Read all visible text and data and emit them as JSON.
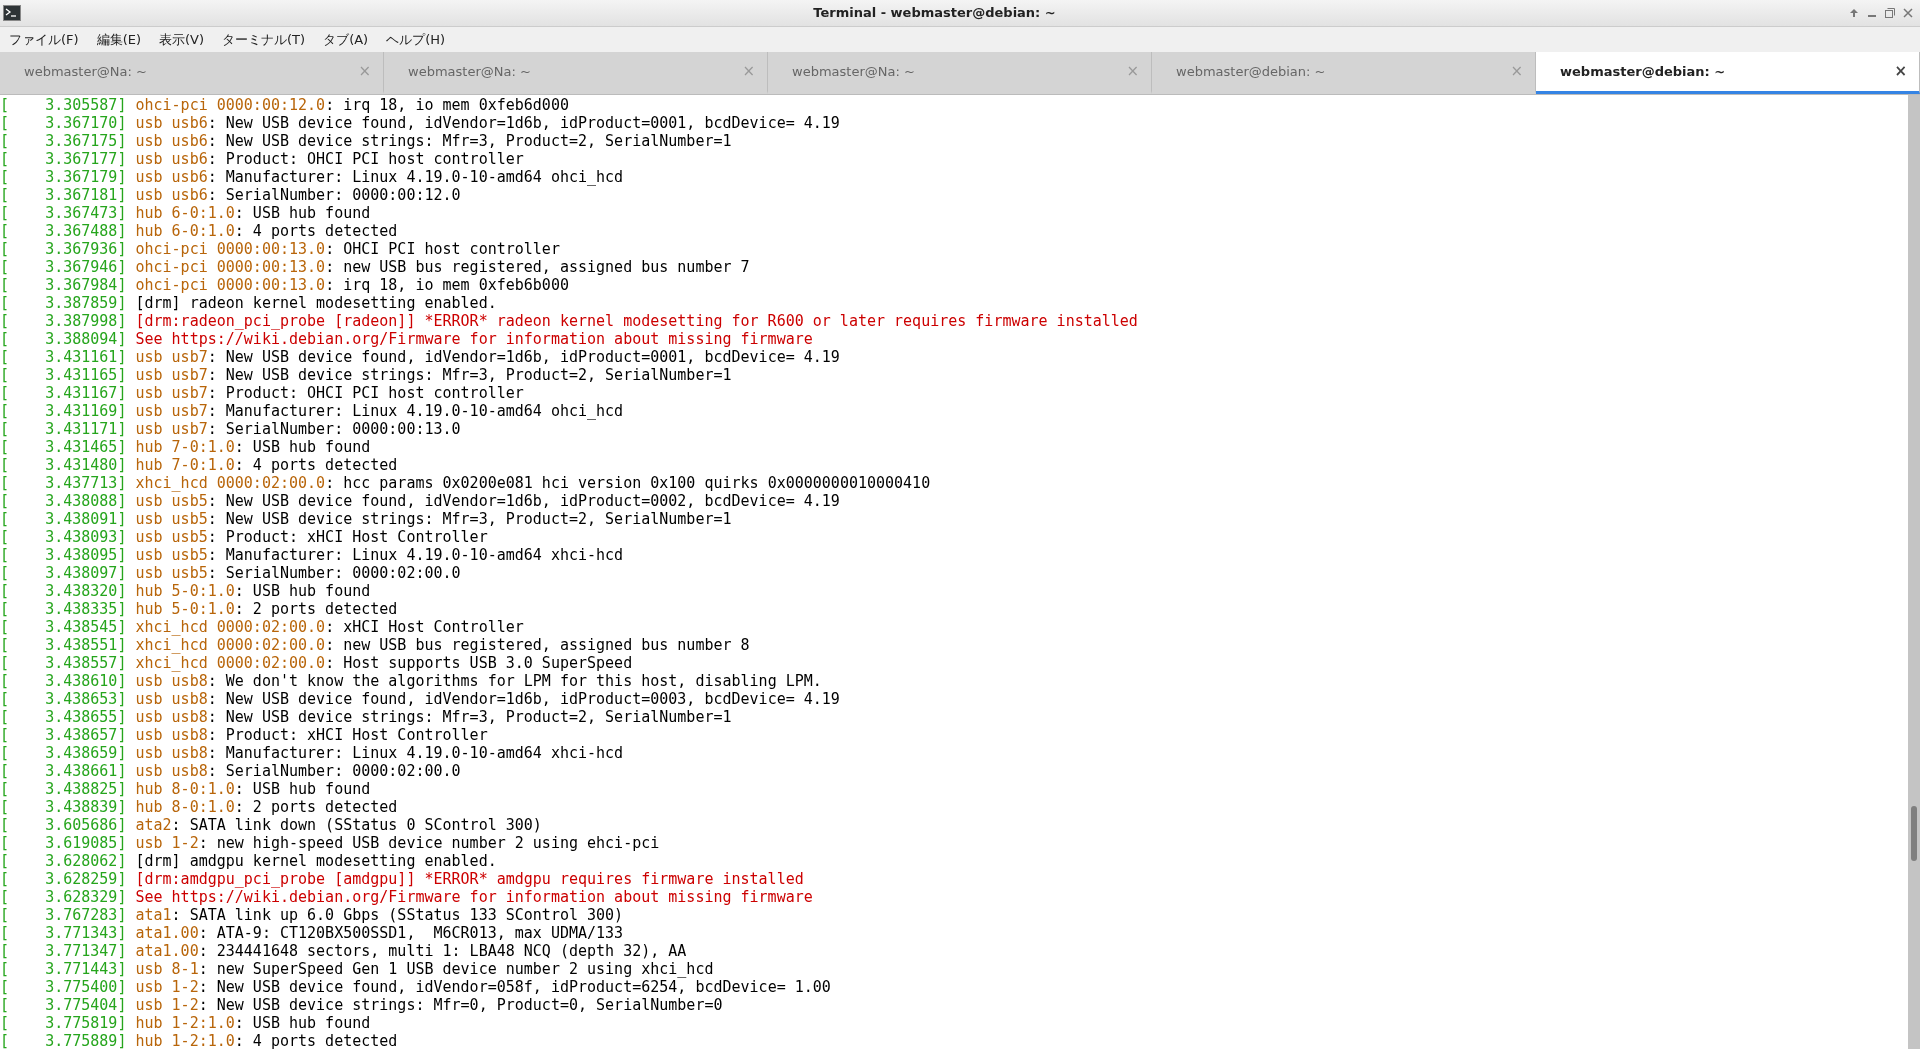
{
  "window": {
    "title": "Terminal - webmaster@debian: ~"
  },
  "menu": [
    "ファイル(F)",
    "編集(E)",
    "表示(V)",
    "ターミナル(T)",
    "タブ(A)",
    "ヘルプ(H)"
  ],
  "tabs": [
    {
      "label": "webmaster@Na: ~",
      "selected": false
    },
    {
      "label": "webmaster@Na: ~",
      "selected": false
    },
    {
      "label": "webmaster@Na: ~",
      "selected": false
    },
    {
      "label": "webmaster@debian: ~",
      "selected": false
    },
    {
      "label": "webmaster@debian: ~",
      "selected": true
    }
  ],
  "tab_close": "×",
  "lines": [
    {
      "kind": "normal",
      "timestamp": "[    3.305587]",
      "source": "ohci-pci 0000:00:12.0",
      "text": ": irq 18, io mem 0xfeb6d000"
    },
    {
      "kind": "normal",
      "timestamp": "[    3.367170]",
      "source": "usb usb6",
      "text": ": New USB device found, idVendor=1d6b, idProduct=0001, bcdDevice= 4.19"
    },
    {
      "kind": "normal",
      "timestamp": "[    3.367175]",
      "source": "usb usb6",
      "text": ": New USB device strings: Mfr=3, Product=2, SerialNumber=1"
    },
    {
      "kind": "normal",
      "timestamp": "[    3.367177]",
      "source": "usb usb6",
      "text": ": Product: OHCI PCI host controller"
    },
    {
      "kind": "normal",
      "timestamp": "[    3.367179]",
      "source": "usb usb6",
      "text": ": Manufacturer: Linux 4.19.0-10-amd64 ohci_hcd"
    },
    {
      "kind": "normal",
      "timestamp": "[    3.367181]",
      "source": "usb usb6",
      "text": ": SerialNumber: 0000:00:12.0"
    },
    {
      "kind": "normal",
      "timestamp": "[    3.367473]",
      "source": "hub 6-0:1.0",
      "text": ": USB hub found"
    },
    {
      "kind": "normal",
      "timestamp": "[    3.367488]",
      "source": "hub 6-0:1.0",
      "text": ": 4 ports detected"
    },
    {
      "kind": "normal",
      "timestamp": "[    3.367936]",
      "source": "ohci-pci 0000:00:13.0",
      "text": ": OHCI PCI host controller"
    },
    {
      "kind": "normal",
      "timestamp": "[    3.367946]",
      "source": "ohci-pci 0000:00:13.0",
      "text": ": new USB bus registered, assigned bus number 7"
    },
    {
      "kind": "normal",
      "timestamp": "[    3.367984]",
      "source": "ohci-pci 0000:00:13.0",
      "text": ": irq 18, io mem 0xfeb6b000"
    },
    {
      "kind": "normal",
      "timestamp": "[    3.387859]",
      "text": "[drm] radeon kernel modesetting enabled."
    },
    {
      "kind": "error",
      "timestamp": "[    3.387998]",
      "text": "[drm:radeon_pci_probe [radeon]] *ERROR* radeon kernel modesetting for R600 or later requires firmware installed"
    },
    {
      "kind": "error",
      "timestamp": "[    3.388094]",
      "text": "See https://wiki.debian.org/Firmware for information about missing firmware"
    },
    {
      "kind": "normal",
      "timestamp": "[    3.431161]",
      "source": "usb usb7",
      "text": ": New USB device found, idVendor=1d6b, idProduct=0001, bcdDevice= 4.19"
    },
    {
      "kind": "normal",
      "timestamp": "[    3.431165]",
      "source": "usb usb7",
      "text": ": New USB device strings: Mfr=3, Product=2, SerialNumber=1"
    },
    {
      "kind": "normal",
      "timestamp": "[    3.431167]",
      "source": "usb usb7",
      "text": ": Product: OHCI PCI host controller"
    },
    {
      "kind": "normal",
      "timestamp": "[    3.431169]",
      "source": "usb usb7",
      "text": ": Manufacturer: Linux 4.19.0-10-amd64 ohci_hcd"
    },
    {
      "kind": "normal",
      "timestamp": "[    3.431171]",
      "source": "usb usb7",
      "text": ": SerialNumber: 0000:00:13.0"
    },
    {
      "kind": "normal",
      "timestamp": "[    3.431465]",
      "source": "hub 7-0:1.0",
      "text": ": USB hub found"
    },
    {
      "kind": "normal",
      "timestamp": "[    3.431480]",
      "source": "hub 7-0:1.0",
      "text": ": 4 ports detected"
    },
    {
      "kind": "normal",
      "timestamp": "[    3.437713]",
      "source": "xhci_hcd 0000:02:00.0",
      "text": ": hcc params 0x0200e081 hci version 0x100 quirks 0x0000000010000410"
    },
    {
      "kind": "normal",
      "timestamp": "[    3.438088]",
      "source": "usb usb5",
      "text": ": New USB device found, idVendor=1d6b, idProduct=0002, bcdDevice= 4.19"
    },
    {
      "kind": "normal",
      "timestamp": "[    3.438091]",
      "source": "usb usb5",
      "text": ": New USB device strings: Mfr=3, Product=2, SerialNumber=1"
    },
    {
      "kind": "normal",
      "timestamp": "[    3.438093]",
      "source": "usb usb5",
      "text": ": Product: xHCI Host Controller"
    },
    {
      "kind": "normal",
      "timestamp": "[    3.438095]",
      "source": "usb usb5",
      "text": ": Manufacturer: Linux 4.19.0-10-amd64 xhci-hcd"
    },
    {
      "kind": "normal",
      "timestamp": "[    3.438097]",
      "source": "usb usb5",
      "text": ": SerialNumber: 0000:02:00.0"
    },
    {
      "kind": "normal",
      "timestamp": "[    3.438320]",
      "source": "hub 5-0:1.0",
      "text": ": USB hub found"
    },
    {
      "kind": "normal",
      "timestamp": "[    3.438335]",
      "source": "hub 5-0:1.0",
      "text": ": 2 ports detected"
    },
    {
      "kind": "normal",
      "timestamp": "[    3.438545]",
      "source": "xhci_hcd 0000:02:00.0",
      "text": ": xHCI Host Controller"
    },
    {
      "kind": "normal",
      "timestamp": "[    3.438551]",
      "source": "xhci_hcd 0000:02:00.0",
      "text": ": new USB bus registered, assigned bus number 8"
    },
    {
      "kind": "normal",
      "timestamp": "[    3.438557]",
      "source": "xhci_hcd 0000:02:00.0",
      "text": ": Host supports USB 3.0 SuperSpeed"
    },
    {
      "kind": "normal",
      "timestamp": "[    3.438610]",
      "source": "usb usb8",
      "text": ": We don't know the algorithms for LPM for this host, disabling LPM."
    },
    {
      "kind": "normal",
      "timestamp": "[    3.438653]",
      "source": "usb usb8",
      "text": ": New USB device found, idVendor=1d6b, idProduct=0003, bcdDevice= 4.19"
    },
    {
      "kind": "normal",
      "timestamp": "[    3.438655]",
      "source": "usb usb8",
      "text": ": New USB device strings: Mfr=3, Product=2, SerialNumber=1"
    },
    {
      "kind": "normal",
      "timestamp": "[    3.438657]",
      "source": "usb usb8",
      "text": ": Product: xHCI Host Controller"
    },
    {
      "kind": "normal",
      "timestamp": "[    3.438659]",
      "source": "usb usb8",
      "text": ": Manufacturer: Linux 4.19.0-10-amd64 xhci-hcd"
    },
    {
      "kind": "normal",
      "timestamp": "[    3.438661]",
      "source": "usb usb8",
      "text": ": SerialNumber: 0000:02:00.0"
    },
    {
      "kind": "normal",
      "timestamp": "[    3.438825]",
      "source": "hub 8-0:1.0",
      "text": ": USB hub found"
    },
    {
      "kind": "normal",
      "timestamp": "[    3.438839]",
      "source": "hub 8-0:1.0",
      "text": ": 2 ports detected"
    },
    {
      "kind": "normal",
      "timestamp": "[    3.605686]",
      "source": "ata2",
      "text": ": SATA link down (SStatus 0 SControl 300)"
    },
    {
      "kind": "normal",
      "timestamp": "[    3.619085]",
      "source": "usb 1-2",
      "text": ": new high-speed USB device number 2 using ehci-pci"
    },
    {
      "kind": "normal",
      "timestamp": "[    3.628062]",
      "text": "[drm] amdgpu kernel modesetting enabled."
    },
    {
      "kind": "error",
      "timestamp": "[    3.628259]",
      "text": "[drm:amdgpu_pci_probe [amdgpu]] *ERROR* amdgpu requires firmware installed"
    },
    {
      "kind": "error",
      "timestamp": "[    3.628329]",
      "text": "See https://wiki.debian.org/Firmware for information about missing firmware"
    },
    {
      "kind": "normal",
      "timestamp": "[    3.767283]",
      "source": "ata1",
      "text": ": SATA link up 6.0 Gbps (SStatus 133 SControl 300)"
    },
    {
      "kind": "normal",
      "timestamp": "[    3.771343]",
      "source": "ata1.00",
      "text": ": ATA-9: CT120BX500SSD1,  M6CR013, max UDMA/133"
    },
    {
      "kind": "normal",
      "timestamp": "[    3.771347]",
      "source": "ata1.00",
      "text": ": 234441648 sectors, multi 1: LBA48 NCQ (depth 32), AA"
    },
    {
      "kind": "normal",
      "timestamp": "[    3.771443]",
      "source": "usb 8-1",
      "text": ": new SuperSpeed Gen 1 USB device number 2 using xhci_hcd"
    },
    {
      "kind": "normal",
      "timestamp": "[    3.775400]",
      "source": "usb 1-2",
      "text": ": New USB device found, idVendor=058f, idProduct=6254, bcdDevice= 1.00"
    },
    {
      "kind": "normal",
      "timestamp": "[    3.775404]",
      "source": "usb 1-2",
      "text": ": New USB device strings: Mfr=0, Product=0, SerialNumber=0"
    },
    {
      "kind": "normal",
      "timestamp": "[    3.775819]",
      "source": "hub 1-2:1.0",
      "text": ": USB hub found"
    },
    {
      "kind": "normal",
      "timestamp": "[    3.775889]",
      "source": "hub 1-2:1.0",
      "text": ": 4 ports detected"
    }
  ]
}
